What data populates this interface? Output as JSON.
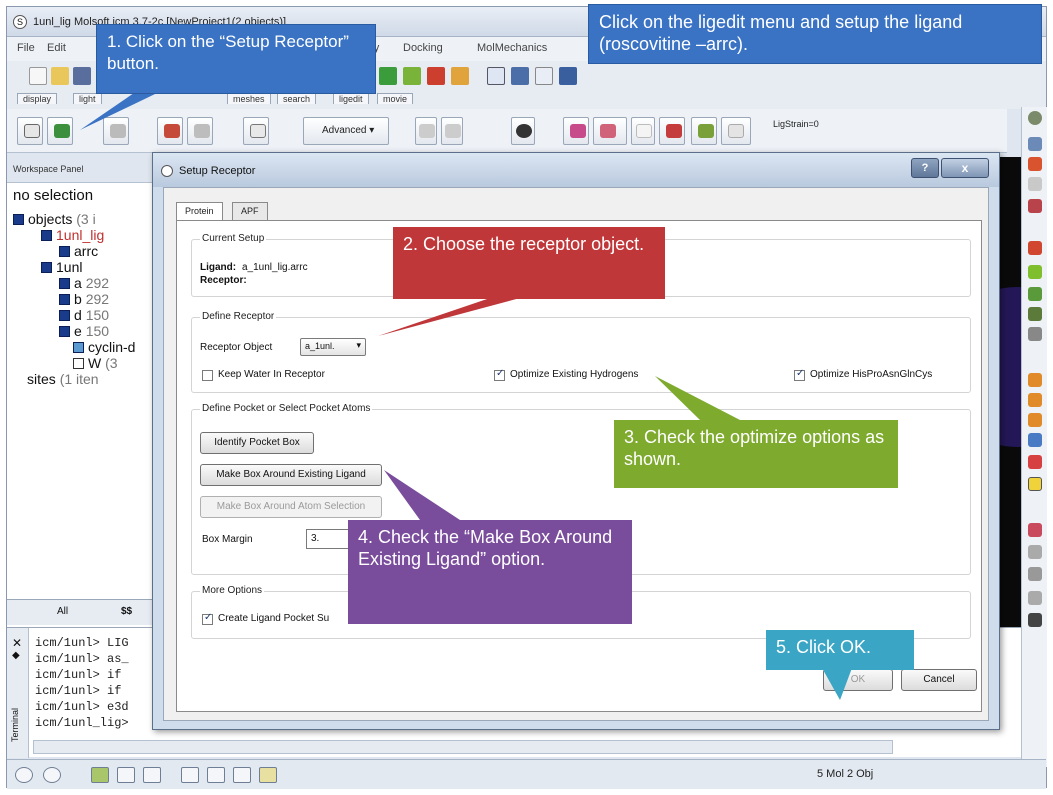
{
  "window": {
    "title": "1unl_lig Molsoft icm 3.7-2c [NewProject1(2 objects)]"
  },
  "menu": [
    "File",
    "Edit",
    "try",
    "Docking",
    "MolMechanics"
  ],
  "tabs": [
    "display",
    "light",
    "meshes",
    "search",
    "ligedit",
    "movie"
  ],
  "toolbar": {
    "advanced_label": "Advanced",
    "ligstrain_label": "LigStrain=0"
  },
  "workspace": {
    "header": "Workspace Panel",
    "selection": "no selection",
    "tree": [
      {
        "label": "objects",
        "count": "(3 i"
      },
      {
        "label": "1unl_lig",
        "count": ""
      },
      {
        "label": "arrc",
        "count": ""
      },
      {
        "label": "1unl",
        "count": ""
      },
      {
        "label": "a",
        "count": "292"
      },
      {
        "label": "b",
        "count": "292"
      },
      {
        "label": "d",
        "count": "150"
      },
      {
        "label": "e",
        "count": "150"
      },
      {
        "label": "cyclin-d",
        "count": ""
      },
      {
        "label": "W",
        "count": "(3"
      },
      {
        "label": "sites",
        "count": "(1 iten"
      }
    ],
    "bottom_tab": "All"
  },
  "terminal": {
    "side_label": "Terminal",
    "lines": [
      "icm/1unl> LIG",
      "icm/1unl> as_",
      "icm/1unl> if",
      "icm/1unl> if",
      "icm/1unl> e3d",
      "icm/1unl_lig>"
    ]
  },
  "statusbar": {
    "status": "5 Mol 2 Obj"
  },
  "dialog": {
    "title": "Setup Receptor",
    "help": "?",
    "close": "x",
    "tabs": [
      "Protein",
      "APF"
    ],
    "current_setup": {
      "label": "Current Setup",
      "ligand_label": "Ligand:",
      "ligand_value": "a_1unl_lig.arrc",
      "receptor_label": "Receptor:"
    },
    "define_receptor": {
      "label": "Define Receptor",
      "object_label": "Receptor Object",
      "object_value": "a_1unl.",
      "keep_water": "Keep Water In Receptor",
      "opt_hydrogens": "Optimize Existing Hydrogens",
      "opt_his": "Optimize HisProAsnGlnCys"
    },
    "pocket": {
      "label": "Define Pocket or Select Pocket Atoms",
      "identify": "Identify Pocket Box",
      "make_box_ligand": "Make Box Around Existing Ligand",
      "make_box_atom": "Make Box Around Atom Selection",
      "margin_label": "Box Margin",
      "margin_value": "3."
    },
    "more": {
      "label": "More Options",
      "create_surface": "Create Ligand Pocket Su"
    },
    "ok": "OK",
    "cancel": "Cancel"
  },
  "annotations": {
    "step1": "1. Click on the “Setup Receptor” button.",
    "top_note": "Click on the ligedit menu and setup the ligand (roscovitine –arrc).",
    "step2": "2. Choose the receptor object.",
    "step3": "3. Check the optimize options as shown.",
    "step4": "4. Check the “Make Box Around Existing Ligand” option.",
    "step5": "5. Click OK."
  },
  "colors": {
    "callout_blue": "#3a73c4",
    "callout_red": "#c0373a",
    "callout_green": "#7eaa2e",
    "callout_purple": "#7a4c9c",
    "callout_teal": "#3aa5c4"
  }
}
